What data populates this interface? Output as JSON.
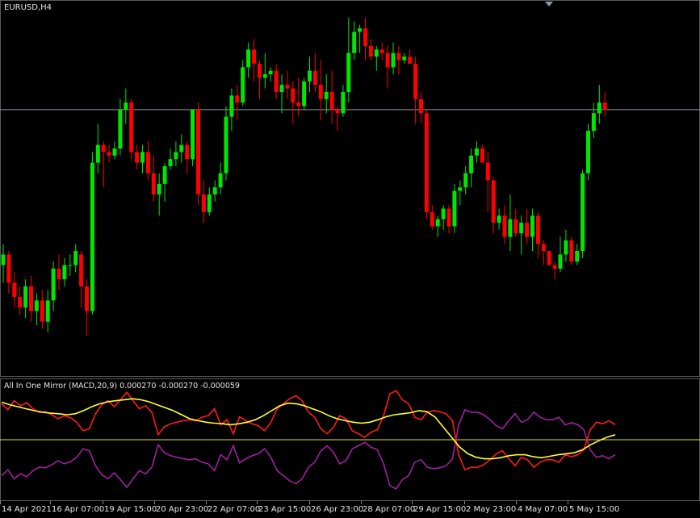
{
  "symbol_label": "EURUSD,H4",
  "indicator_label": "All In One Mirror (MACD,20,9) 0.000270 -0.000270 -0.000059",
  "colors": {
    "background": "#000000",
    "bull": "#00e600",
    "bear": "#ff0000",
    "grid_line": "#8a9ba8",
    "indicator_red": "#ff1a1a",
    "indicator_purple": "#a020a0",
    "indicator_yellow": "#ffff33",
    "zero_line": "#e6e600",
    "text": "#e6e6e6"
  },
  "time_axis": {
    "labels": [
      "14 Apr 2021",
      "16 Apr 07:00",
      "19 Apr 15:00",
      "20 Apr 23:00",
      "22 Apr 07:00",
      "23 Apr 15:00",
      "26 Apr 23:00",
      "28 Apr 07:00",
      "29 Apr 15:00",
      "2 May 23:00",
      "4 May 07:00",
      "5 May 15:00"
    ]
  },
  "chart_data": {
    "type": "candlestick",
    "title": "EURUSD,H4",
    "series": [
      {
        "name": "EURUSD",
        "candles": [
          [
            0.3,
            0.36,
            0.25,
            0.33
          ],
          [
            0.33,
            0.34,
            0.22,
            0.25
          ],
          [
            0.25,
            0.28,
            0.18,
            0.21
          ],
          [
            0.21,
            0.24,
            0.16,
            0.18
          ],
          [
            0.18,
            0.26,
            0.15,
            0.24
          ],
          [
            0.24,
            0.27,
            0.14,
            0.17
          ],
          [
            0.17,
            0.22,
            0.13,
            0.2
          ],
          [
            0.2,
            0.23,
            0.12,
            0.14
          ],
          [
            0.14,
            0.23,
            0.11,
            0.2
          ],
          [
            0.2,
            0.31,
            0.17,
            0.29
          ],
          [
            0.29,
            0.33,
            0.23,
            0.26
          ],
          [
            0.26,
            0.32,
            0.24,
            0.3
          ],
          [
            0.3,
            0.33,
            0.27,
            0.3
          ],
          [
            0.3,
            0.36,
            0.28,
            0.34
          ],
          [
            0.33,
            0.34,
            0.18,
            0.24
          ],
          [
            0.24,
            0.26,
            0.1,
            0.17
          ],
          [
            0.17,
            0.62,
            0.16,
            0.59
          ],
          [
            0.59,
            0.7,
            0.56,
            0.64
          ],
          [
            0.64,
            0.65,
            0.52,
            0.62
          ],
          [
            0.62,
            0.64,
            0.59,
            0.61
          ],
          [
            0.61,
            0.65,
            0.6,
            0.63
          ],
          [
            0.63,
            0.77,
            0.61,
            0.74
          ],
          [
            0.74,
            0.8,
            0.7,
            0.76
          ],
          [
            0.76,
            0.77,
            0.6,
            0.62
          ],
          [
            0.62,
            0.64,
            0.57,
            0.59
          ],
          [
            0.59,
            0.64,
            0.56,
            0.62
          ],
          [
            0.62,
            0.65,
            0.54,
            0.56
          ],
          [
            0.56,
            0.61,
            0.48,
            0.5
          ],
          [
            0.5,
            0.56,
            0.44,
            0.53
          ],
          [
            0.53,
            0.59,
            0.48,
            0.58
          ],
          [
            0.58,
            0.63,
            0.57,
            0.6
          ],
          [
            0.6,
            0.65,
            0.58,
            0.62
          ],
          [
            0.62,
            0.67,
            0.59,
            0.64
          ],
          [
            0.64,
            0.65,
            0.56,
            0.6
          ],
          [
            0.6,
            0.71,
            0.58,
            0.74
          ],
          [
            0.74,
            0.76,
            0.47,
            0.5
          ],
          [
            0.5,
            0.54,
            0.42,
            0.45
          ],
          [
            0.45,
            0.52,
            0.44,
            0.5
          ],
          [
            0.5,
            0.54,
            0.48,
            0.52
          ],
          [
            0.52,
            0.59,
            0.5,
            0.56
          ],
          [
            0.56,
            0.75,
            0.54,
            0.72
          ],
          [
            0.72,
            0.8,
            0.68,
            0.78
          ],
          [
            0.78,
            0.81,
            0.71,
            0.76
          ],
          [
            0.76,
            0.88,
            0.75,
            0.86
          ],
          [
            0.86,
            0.93,
            0.83,
            0.91
          ],
          [
            0.91,
            0.94,
            0.82,
            0.87
          ],
          [
            0.87,
            0.88,
            0.77,
            0.83
          ],
          [
            0.83,
            0.9,
            0.8,
            0.84
          ],
          [
            0.84,
            0.86,
            0.82,
            0.85
          ],
          [
            0.85,
            0.87,
            0.77,
            0.79
          ],
          [
            0.79,
            0.84,
            0.73,
            0.81
          ],
          [
            0.81,
            0.85,
            0.77,
            0.8
          ],
          [
            0.8,
            0.82,
            0.7,
            0.76
          ],
          [
            0.76,
            0.83,
            0.72,
            0.75
          ],
          [
            0.75,
            0.83,
            0.74,
            0.82
          ],
          [
            0.82,
            0.89,
            0.79,
            0.85
          ],
          [
            0.85,
            0.9,
            0.79,
            0.81
          ],
          [
            0.81,
            0.88,
            0.71,
            0.77
          ],
          [
            0.77,
            0.84,
            0.73,
            0.79
          ],
          [
            0.79,
            0.85,
            0.7,
            0.74
          ],
          [
            0.74,
            0.75,
            0.68,
            0.73
          ],
          [
            0.73,
            0.81,
            0.72,
            0.79
          ],
          [
            0.79,
            1.0,
            0.76,
            0.9
          ],
          [
            0.9,
            0.99,
            0.88,
            0.96
          ],
          [
            0.96,
            0.98,
            0.9,
            0.97
          ],
          [
            0.97,
            1.0,
            0.88,
            0.92
          ],
          [
            0.92,
            0.94,
            0.88,
            0.89
          ],
          [
            0.89,
            0.92,
            0.85,
            0.91
          ],
          [
            0.91,
            0.93,
            0.88,
            0.9
          ],
          [
            0.9,
            0.92,
            0.8,
            0.86
          ],
          [
            0.86,
            0.93,
            0.84,
            0.9
          ],
          [
            0.9,
            0.92,
            0.84,
            0.88
          ],
          [
            0.88,
            0.9,
            0.87,
            0.89
          ],
          [
            0.89,
            0.91,
            0.87,
            0.87
          ],
          [
            0.87,
            0.89,
            0.7,
            0.77
          ],
          [
            0.77,
            0.79,
            0.7,
            0.73
          ],
          [
            0.73,
            0.74,
            0.43,
            0.45
          ],
          [
            0.45,
            0.47,
            0.4,
            0.41
          ],
          [
            0.41,
            0.44,
            0.38,
            0.43
          ],
          [
            0.43,
            0.47,
            0.4,
            0.46
          ],
          [
            0.46,
            0.47,
            0.39,
            0.41
          ],
          [
            0.41,
            0.53,
            0.39,
            0.51
          ],
          [
            0.51,
            0.54,
            0.47,
            0.52
          ],
          [
            0.52,
            0.58,
            0.5,
            0.56
          ],
          [
            0.56,
            0.63,
            0.52,
            0.61
          ],
          [
            0.61,
            0.65,
            0.59,
            0.63
          ],
          [
            0.63,
            0.64,
            0.6,
            0.59
          ],
          [
            0.59,
            0.62,
            0.45,
            0.54
          ],
          [
            0.54,
            0.55,
            0.39,
            0.42
          ],
          [
            0.42,
            0.46,
            0.4,
            0.44
          ],
          [
            0.44,
            0.47,
            0.36,
            0.38
          ],
          [
            0.38,
            0.5,
            0.34,
            0.43
          ],
          [
            0.43,
            0.46,
            0.38,
            0.39
          ],
          [
            0.39,
            0.44,
            0.33,
            0.42
          ],
          [
            0.42,
            0.46,
            0.36,
            0.38
          ],
          [
            0.38,
            0.46,
            0.34,
            0.44
          ],
          [
            0.44,
            0.45,
            0.32,
            0.36
          ],
          [
            0.36,
            0.37,
            0.3,
            0.34
          ],
          [
            0.34,
            0.34,
            0.31,
            0.3
          ],
          [
            0.3,
            0.31,
            0.26,
            0.29
          ],
          [
            0.29,
            0.38,
            0.28,
            0.33
          ],
          [
            0.33,
            0.4,
            0.31,
            0.37
          ],
          [
            0.37,
            0.38,
            0.3,
            0.31
          ],
          [
            0.31,
            0.36,
            0.3,
            0.34
          ],
          [
            0.34,
            0.57,
            0.32,
            0.56
          ],
          [
            0.56,
            0.7,
            0.54,
            0.68
          ],
          [
            0.68,
            0.76,
            0.66,
            0.73
          ],
          [
            0.73,
            0.81,
            0.7,
            0.76
          ],
          [
            0.76,
            0.79,
            0.72,
            0.74
          ]
        ]
      }
    ],
    "current_price_level": 0.74,
    "indicator": {
      "name": "All In One Mirror (MACD,20,9)",
      "values": [
        0.00027,
        -0.00027,
        -5.9e-05
      ],
      "red": [
        0.72,
        0.6,
        0.78,
        0.68,
        0.74,
        0.62,
        0.55,
        0.56,
        0.5,
        0.42,
        0.48,
        0.44,
        0.35,
        0.18,
        0.22,
        0.52,
        0.7,
        0.78,
        0.66,
        0.8,
        0.95,
        0.78,
        0.62,
        0.68,
        0.55,
        0.1,
        0.26,
        0.32,
        0.35,
        0.38,
        0.4,
        0.38,
        0.45,
        0.48,
        0.62,
        0.3,
        0.4,
        0.12,
        0.46,
        0.38,
        0.32,
        0.28,
        0.18,
        0.35,
        0.62,
        0.72,
        0.82,
        0.88,
        0.78,
        0.55,
        0.45,
        0.22,
        0.12,
        0.25,
        0.48,
        0.42,
        0.18,
        0.12,
        0.05,
        0.15,
        0.2,
        0.48,
        0.92,
        0.98,
        0.8,
        0.72,
        0.45,
        0.4,
        0.55,
        0.58,
        0.56,
        0.52,
        0.38,
        -0.3,
        -0.6,
        -0.55,
        -0.55,
        -0.5,
        -0.4,
        -0.28,
        -0.22,
        -0.38,
        -0.52,
        -0.35,
        -0.4,
        -0.55,
        -0.45,
        -0.4,
        -0.4,
        -0.45,
        -0.3,
        -0.34,
        -0.3,
        -0.2,
        0.2,
        0.35,
        0.32,
        0.38,
        0.3
      ],
      "yellow": [
        0.75,
        0.7,
        0.66,
        0.62,
        0.58,
        0.55,
        0.53,
        0.52,
        0.5,
        0.52,
        0.58,
        0.66,
        0.72,
        0.76,
        0.78,
        0.8,
        0.82,
        0.8,
        0.76,
        0.7,
        0.64,
        0.58,
        0.5,
        0.42,
        0.38,
        0.35,
        0.33,
        0.32,
        0.3,
        0.32,
        0.35,
        0.4,
        0.48,
        0.58,
        0.68,
        0.73,
        0.72,
        0.68,
        0.62,
        0.56,
        0.48,
        0.42,
        0.38,
        0.35,
        0.33,
        0.35,
        0.4,
        0.46,
        0.5,
        0.52,
        0.54,
        0.58,
        0.56,
        0.45,
        0.25,
        0.05,
        -0.15,
        -0.28,
        -0.35,
        -0.38,
        -0.38,
        -0.36,
        -0.32,
        -0.3,
        -0.3,
        -0.34,
        -0.36,
        -0.33,
        -0.3,
        -0.28,
        -0.26,
        -0.2,
        -0.1,
        -0.02,
        0.05,
        0.1
      ],
      "zero_level": 0
    }
  }
}
